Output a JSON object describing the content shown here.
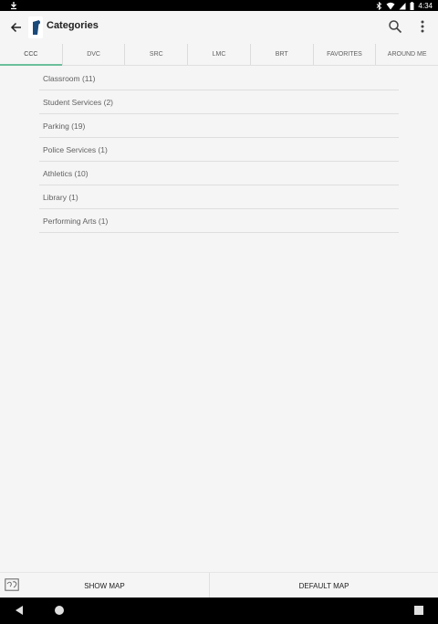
{
  "status_bar": {
    "time": "4:34",
    "icons": [
      "download-icon",
      "bluetooth-icon",
      "wifi-icon",
      "cell-signal-icon",
      "battery-icon"
    ]
  },
  "toolbar": {
    "title": "Categories",
    "back_icon": "arrow-back-icon",
    "search_icon": "search-icon",
    "more_icon": "more-vert-icon",
    "brand_color": "#1a4a7a"
  },
  "tabs": [
    {
      "label": "CCC",
      "active": true
    },
    {
      "label": "DVC",
      "active": false
    },
    {
      "label": "SRC",
      "active": false
    },
    {
      "label": "LMC",
      "active": false
    },
    {
      "label": "BRT",
      "active": false
    },
    {
      "label": "FAVORITES",
      "active": false
    },
    {
      "label": "AROUND ME",
      "active": false
    }
  ],
  "accent_color": "#6cbf9b",
  "categories": [
    {
      "label": "Classroom (11)"
    },
    {
      "label": "Student Services (2)"
    },
    {
      "label": "Parking (19)"
    },
    {
      "label": "Police Services (1)"
    },
    {
      "label": "Athletics (10)"
    },
    {
      "label": "Library (1)"
    },
    {
      "label": "Performing Arts (1)"
    }
  ],
  "bottom_bar": {
    "show_map_label": "SHOW MAP",
    "default_map_label": "DEFAULT MAP",
    "map_icon": "map-icon"
  },
  "nav_bar": {
    "icons": [
      "nav-back-icon",
      "nav-home-icon",
      "nav-recents-icon"
    ]
  }
}
